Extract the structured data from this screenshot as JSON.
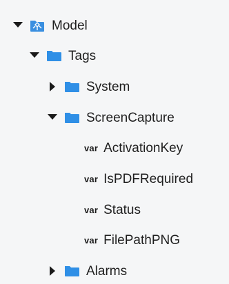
{
  "colors": {
    "folder": "#2f8fe6",
    "arrow": "#1a1a1a",
    "model": "#3a8fe0"
  },
  "tree": {
    "model": {
      "label": "Model",
      "icon": "model-icon",
      "expanded": true
    },
    "tags": {
      "label": "Tags",
      "icon": "folder-icon",
      "expanded": true
    },
    "system": {
      "label": "System",
      "icon": "folder-icon",
      "expanded": false
    },
    "screencapture": {
      "label": "ScreenCapture",
      "icon": "folder-icon",
      "expanded": true
    },
    "vars": [
      {
        "keyword": "var",
        "label": "ActivationKey"
      },
      {
        "keyword": "var",
        "label": "IsPDFRequired"
      },
      {
        "keyword": "var",
        "label": "Status"
      },
      {
        "keyword": "var",
        "label": "FilePathPNG"
      }
    ],
    "alarms": {
      "label": "Alarms",
      "icon": "folder-icon",
      "expanded": false
    }
  }
}
